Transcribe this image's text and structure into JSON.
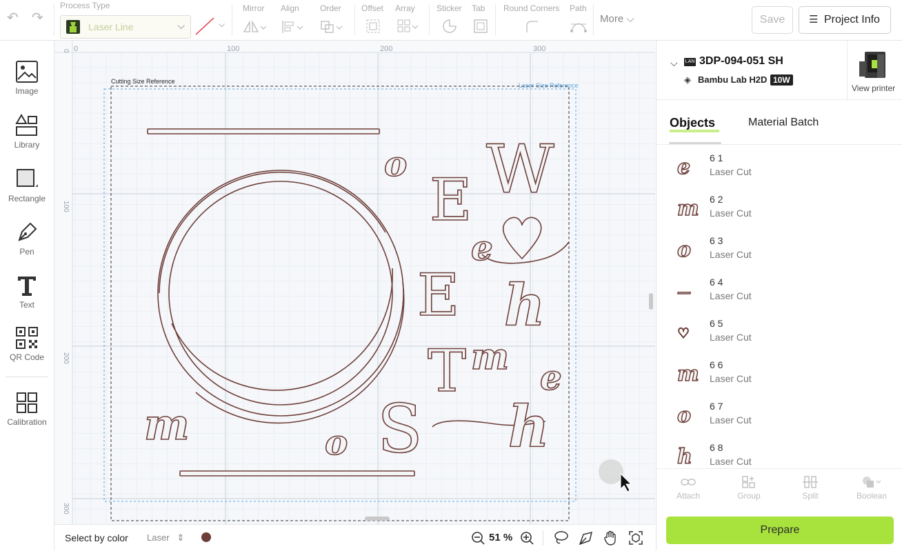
{
  "toolbar": {
    "process_type_label": "Process Type",
    "process_type_value": "Laser Line",
    "groups": {
      "mirror": "Mirror",
      "align": "Align",
      "order": "Order",
      "offset": "Offset",
      "array": "Array",
      "sticker": "Sticker",
      "tab": "Tab",
      "round_corners": "Round Corners",
      "path": "Path"
    },
    "more_label": "More",
    "save_label": "Save",
    "project_info_label": "Project Info"
  },
  "sidebar": {
    "items": [
      {
        "label": "Image",
        "icon": "image-icon"
      },
      {
        "label": "Library",
        "icon": "shapes-icon"
      },
      {
        "label": "Rectangle",
        "icon": "rectangle-icon"
      },
      {
        "label": "Pen",
        "icon": "pen-icon"
      },
      {
        "label": "Text",
        "icon": "text-icon"
      },
      {
        "label": "QR Code",
        "icon": "qr-code-icon"
      },
      {
        "label": "Calibration",
        "icon": "grid-icon"
      }
    ]
  },
  "canvas": {
    "ruler_top": [
      "0",
      "100",
      "200",
      "300"
    ],
    "ruler_left": [
      "0",
      "100",
      "200",
      "300"
    ],
    "cutting_label": "Cutting Size Reference",
    "laser_label": "Laser Size Reference",
    "letters": {
      "w": "W",
      "e1": "E",
      "e2": "E",
      "t": "T",
      "s": "S",
      "o1": "o",
      "o2": "o",
      "m1": "m",
      "m2": "m",
      "h1": "h",
      "h2": "h",
      "e_script1": "e",
      "e_script2": "e"
    },
    "colors": {
      "stroke": "#6e3f3a",
      "grid": "#dde3ea",
      "laser_ref": "#5aa6e0",
      "cut_ref": "#333333"
    }
  },
  "bottombar": {
    "select_by_color": "Select by color",
    "laser_label": "Laser",
    "zoom": "51 %",
    "color_swatch": "#6e3f3a"
  },
  "rightpanel": {
    "printer_name": "3DP-094-051 SH",
    "printer_model": "Bambu Lab H2D",
    "laser_power": "10W",
    "view_printer_label": "View printer",
    "tabs": [
      "Objects",
      "Material Batch"
    ],
    "objects": [
      {
        "name": "6 1",
        "type": "Laser Cut",
        "glyph": "e"
      },
      {
        "name": "6 2",
        "type": "Laser Cut",
        "glyph": "m"
      },
      {
        "name": "6 3",
        "type": "Laser Cut",
        "glyph": "o"
      },
      {
        "name": "6 4",
        "type": "Laser Cut",
        "glyph": "—"
      },
      {
        "name": "6 5",
        "type": "Laser Cut",
        "glyph": "♡"
      },
      {
        "name": "6 6",
        "type": "Laser Cut",
        "glyph": "m"
      },
      {
        "name": "6 7",
        "type": "Laser Cut",
        "glyph": "o"
      },
      {
        "name": "6 8",
        "type": "Laser Cut",
        "glyph": "h"
      }
    ],
    "actions": [
      "Attach",
      "Group",
      "Split",
      "Boolean"
    ],
    "prepare_label": "Prepare",
    "accent": "#a8e23c"
  }
}
